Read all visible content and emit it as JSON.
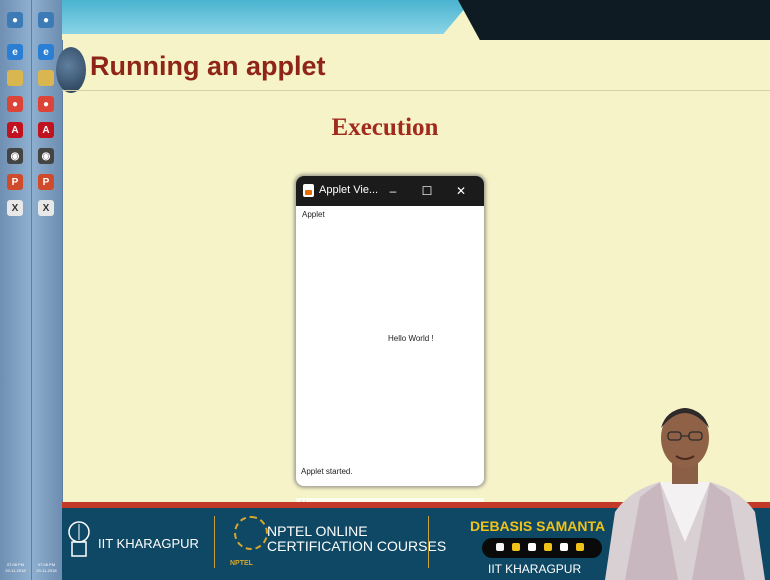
{
  "slide": {
    "title": "Running an applet",
    "subtitle": "Execution"
  },
  "applet_window": {
    "title": "Applet Vie...",
    "minimize_glyph": "–",
    "maximize_glyph": "☐",
    "close_glyph": "✕",
    "menu_label": "Applet",
    "content_text": "Hello World !",
    "status_text": "Applet started."
  },
  "taskbar": {
    "clock_time": "07:08 PM",
    "clock_date": "20-11-2018"
  },
  "footer": {
    "institute": "IIT KHARAGPUR",
    "program_line1": "NPTEL ONLINE",
    "program_line2": "CERTIFICATION COURSES",
    "nptel_mark": "NPTEL",
    "speaker_name": "DEBASIS SAMANTA",
    "speaker_institute": "IIT KHARAGPUR"
  },
  "colors": {
    "background": "#f6f3c8",
    "title_red": "#8f2518",
    "footer_blue": "#0f4864",
    "accent_gold": "#f0c218"
  },
  "icons": [
    "ie-icon",
    "chrome-icon",
    "acrobat-icon",
    "media-icon",
    "powerpoint-icon",
    "x-icon",
    "java-icon"
  ]
}
